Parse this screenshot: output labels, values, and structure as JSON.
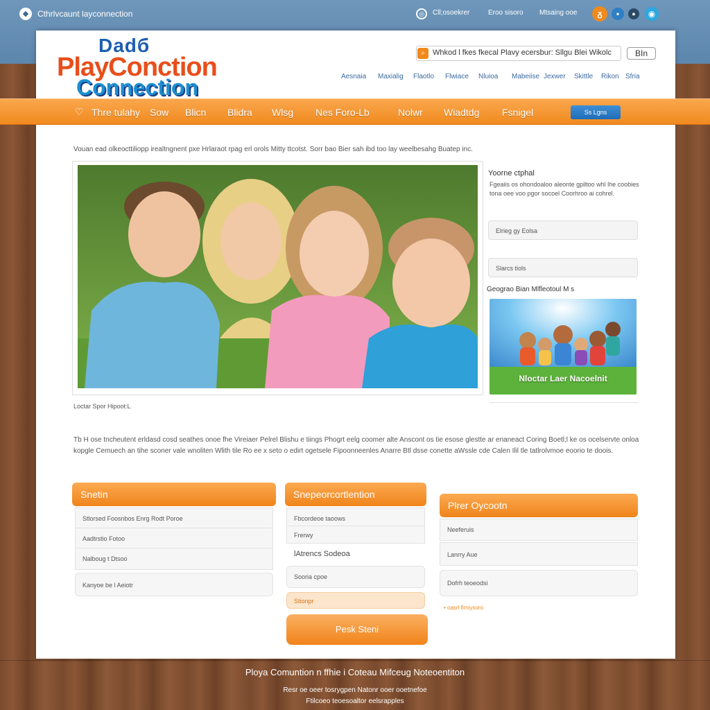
{
  "topbar": {
    "title": "Cthrlvcaunt layconnection",
    "link_1": "Cll;osoekrer",
    "link_2": "Eroo sisoro",
    "link_3": "Mtsaing ooe"
  },
  "header": {
    "logo_top": "Dadб",
    "logo_main": "PlayConction",
    "logo_sub": "Connection",
    "search_text": "Whkod l fkes fkecal Plavy ecersbur: Sllgu Blei Wikolc",
    "lang_button": "BIn",
    "subnav": [
      "Aesnaia",
      "Maxialig",
      "Flaotlo",
      "Flwiace",
      "Nluioa",
      "Mabeiise",
      "Jexwer",
      "Skittle",
      "Rikon",
      "Sfria"
    ]
  },
  "nav": {
    "items": [
      "Thre tulahy",
      "Sow",
      "Blicn",
      "Blidra",
      "Wlsg",
      "Nes Foro-Lb",
      "Nolwr",
      "Wiadtdg",
      "Fsnigel"
    ],
    "button": "Ss Lgns"
  },
  "intro": "Vouan ead olkeocttiliopp irealtngnent pxe Hrlaraot rpag erl orols Mitty ttcotst. Sorr bao Bier sah ibd too lay weelbesahg Buatep inc.",
  "hero_caption": "Loctar Spor Hipoot:L",
  "sidebar": {
    "heading": "Yoorne ctphal",
    "text": "Fgeaiis os ohondoaloo aleonte gpiltoo whl lhe coobies tona oee voo pgor socoel Coorhroo ai cohrel.",
    "field_1": "Elrieg gy Eolsa",
    "field_2": "Slarcs tiols",
    "heading_2": "Geograo Bian Mlfleotoul M s",
    "promo_text": "Nloctar Laer Nacoelnit"
  },
  "body_text": "Tb H ose tncheutent erldasd cosd seathes onoe fhe Vireiaer Pelrel Blishu e tiings Phogrt eelg coomer alte Anscont os tie esose glestte ar enaneact Coring Boetl;l ke os ocelservte onloa kopgle Cemuech an tihe sconer vale wnoliten Wlith tile Ro ee x seto o edirt ogetsele Fipoonneenles Anarre Btl dsse conette aWssle cde Calen Ilil tle tatlrolvmoe eoorio te doois.",
  "col1": {
    "head": "Snetin",
    "rows": [
      "Stlorsed Foosnbos Enrg Rodt Poroe",
      "Aadtrstio Fotoo",
      "Nalboug t Dtsoo",
      "Kanyoe be l Aeiotr"
    ]
  },
  "col2": {
    "head": "Snepeorcortlention",
    "rows": [
      "Fbcordeoe taoows",
      "Frerwy"
    ],
    "label": "lAtrencs Sodeoa",
    "field": "Sooria cpoe",
    "tag": "Stionpr",
    "button": "Pesk Steni"
  },
  "col3": {
    "head": "Plrer Oycootn",
    "rows": [
      "Neeferuis",
      "Lanrry Aue",
      "Dofrh teoeodsi"
    ],
    "link": "• oasrl firniysoro"
  },
  "footer": {
    "line_1": "Ploya Comuntion n ffhie i Coteau Mifceug Noteoentiton",
    "line_2": "Resr oe oeer tosrygpen Natonr ooer ooetnefoe",
    "line_3": "Ftilcoeo teoesoaltor eelsrapples"
  },
  "colors": {
    "orange": "#f18a1f",
    "blue": "#1f6cb6",
    "sky": "#6f97bb"
  }
}
